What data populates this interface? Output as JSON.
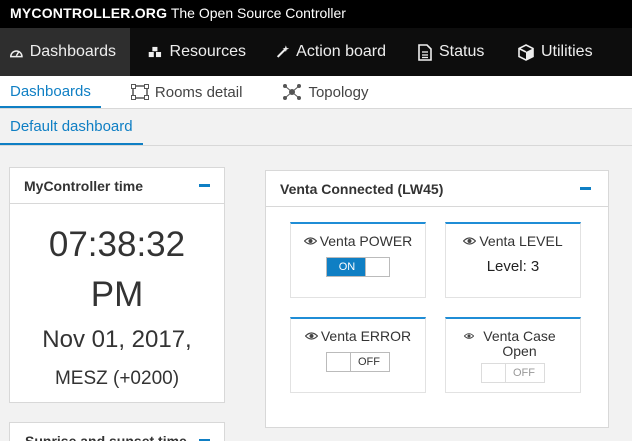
{
  "brand": {
    "name": "MYCONTROLLER.ORG",
    "tagline": "The Open Source Controller"
  },
  "main_nav": {
    "items": [
      {
        "label": "Dashboards",
        "icon": "dashboard-icon",
        "active": true
      },
      {
        "label": "Resources",
        "icon": "cubes-icon",
        "active": false
      },
      {
        "label": "Action board",
        "icon": "magic-wand-icon",
        "active": false
      },
      {
        "label": "Status",
        "icon": "document-icon",
        "active": false
      },
      {
        "label": "Utilities",
        "icon": "cube-icon",
        "active": false
      }
    ]
  },
  "sub_nav": {
    "items": [
      {
        "label": "Dashboards",
        "active": true
      },
      {
        "label": "Rooms detail",
        "icon": "rooms-icon",
        "active": false
      },
      {
        "label": "Topology",
        "icon": "topology-icon",
        "active": false
      }
    ]
  },
  "dashboard_tabs": [
    {
      "label": "Default dashboard",
      "active": true
    }
  ],
  "time_widget": {
    "title": "MyController time",
    "time": "07:38:32",
    "ampm": "PM",
    "date": "Nov 01, 2017,",
    "timezone": "MESZ (+0200)"
  },
  "sun_widget": {
    "title": "Sunrise and sunset time"
  },
  "venta_panel": {
    "title": "Venta Connected (LW45)",
    "power": {
      "label": "Venta POWER",
      "toggle": "ON",
      "state": "on"
    },
    "level": {
      "label": "Venta LEVEL",
      "value": "Level: 3"
    },
    "error": {
      "label": "Venta ERROR",
      "toggle": "OFF",
      "state": "off"
    },
    "case_open": {
      "label": "Venta Case Open",
      "toggle": "OFF",
      "state": "off-disabled"
    }
  },
  "colors": {
    "accent": "#0f7fc4",
    "nav_bg": "#0d0d0d",
    "active_nav_bg": "#2e2e2e"
  }
}
